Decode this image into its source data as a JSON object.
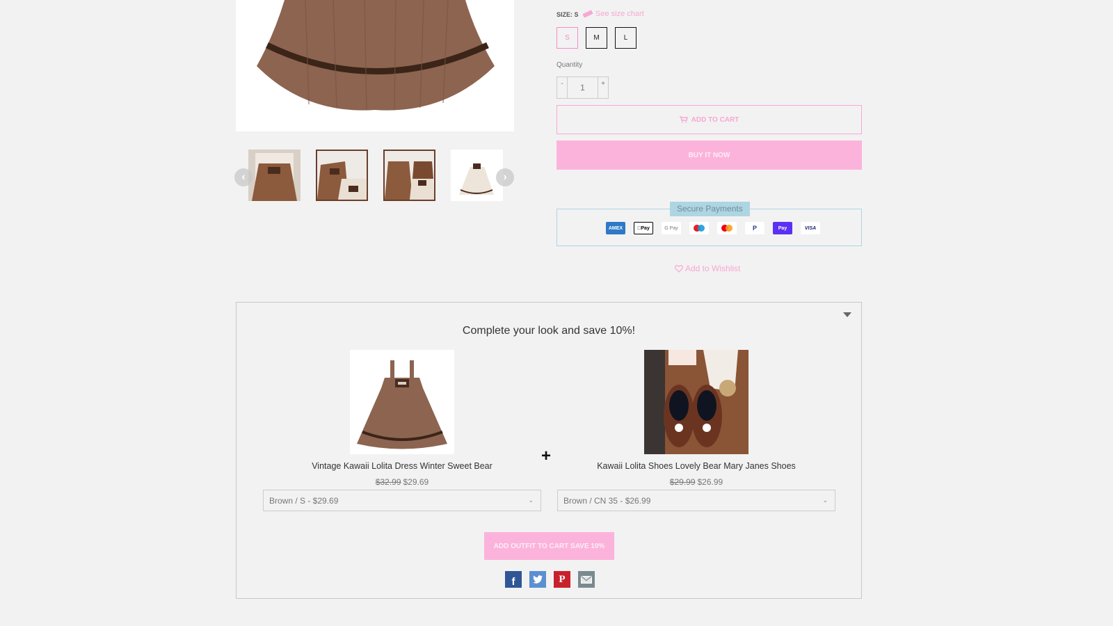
{
  "gallery": {
    "main_image_alt": "Brown kawaii lolita dress skirt",
    "prev_icon": "chevron-left-icon",
    "next_icon": "chevron-right-icon",
    "prev_glyph": "‹",
    "next_glyph": "›",
    "thumbnails": [
      {
        "alt": "Model wearing brown dress with white blouse"
      },
      {
        "alt": "Brown dress and cream dress flat lay"
      },
      {
        "alt": "Brown and cream dress set flat lay"
      },
      {
        "alt": "Cream dress variant"
      }
    ]
  },
  "product": {
    "size_label": "SIZE: S",
    "size_chart_link": "See size chart",
    "sizes": [
      "S",
      "M",
      "L"
    ],
    "selected_size": "S",
    "quantity_label": "Quantity",
    "quantity_minus": "-",
    "quantity_value": "1",
    "quantity_plus": "+",
    "add_to_cart": "ADD TO CART",
    "buy_now": "BUY IT NOW",
    "secure_payments_title": "Secure Payments",
    "payment_methods": [
      "AMEX",
      "Pay",
      "G Pay",
      "Maestro",
      "Mastercard",
      "PayPal",
      "Pay",
      "VISA"
    ],
    "wishlist": "Add to Wishlist"
  },
  "bundle": {
    "title": "Complete your look and save 10%!",
    "plus": "+",
    "items": [
      {
        "name": "Vintage Kawaii Lolita Dress Winter Sweet Bear",
        "old_price": "$32.99",
        "price": "$29.69",
        "variant": "Brown / S - $29.69"
      },
      {
        "name": "Kawaii Lolita Shoes Lovely Bear Mary Janes Shoes",
        "old_price": "$29.99",
        "price": "$26.99",
        "variant": "Brown / CN 35 - $26.99"
      }
    ],
    "add_outfit_button": "ADD OUTFIT TO CART SAVE 10%",
    "share": [
      {
        "name": "facebook",
        "glyph": "f"
      },
      {
        "name": "twitter",
        "glyph": "🐦"
      },
      {
        "name": "pinterest",
        "glyph": "P"
      },
      {
        "name": "email",
        "glyph": "✉"
      }
    ]
  },
  "colors": {
    "accent_pink": "#f7a8d3",
    "button_pink": "#fcb3db",
    "secure_blue": "#aed5e2",
    "background": "#f2f2f2"
  }
}
